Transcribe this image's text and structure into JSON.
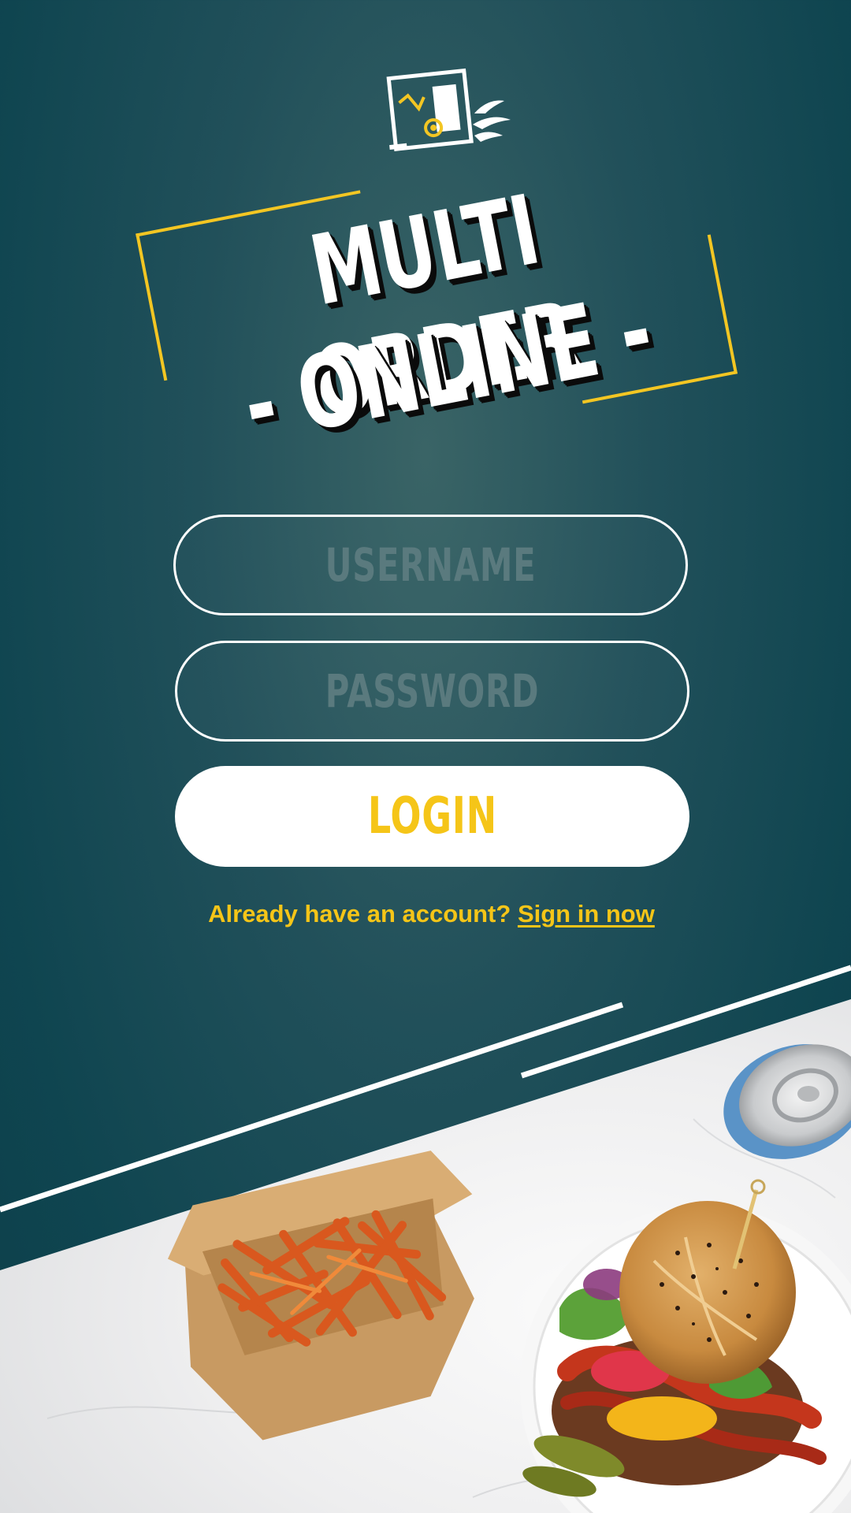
{
  "brand": {
    "title_line1": "MULTI ORDER",
    "title_line2": "- ONLINE -",
    "logo_icon": "delivery-truck-logo-icon",
    "logo_letters": "MO"
  },
  "form": {
    "username_placeholder": "USERNAME",
    "username_value": "",
    "password_placeholder": "PASSWORD",
    "password_value": "",
    "login_label": "LOGIN"
  },
  "footer": {
    "prompt": "Already have an account?",
    "link": "Sign in now"
  },
  "colors": {
    "background": "#0f4550",
    "accent_yellow": "#f5c518",
    "white": "#ffffff"
  }
}
